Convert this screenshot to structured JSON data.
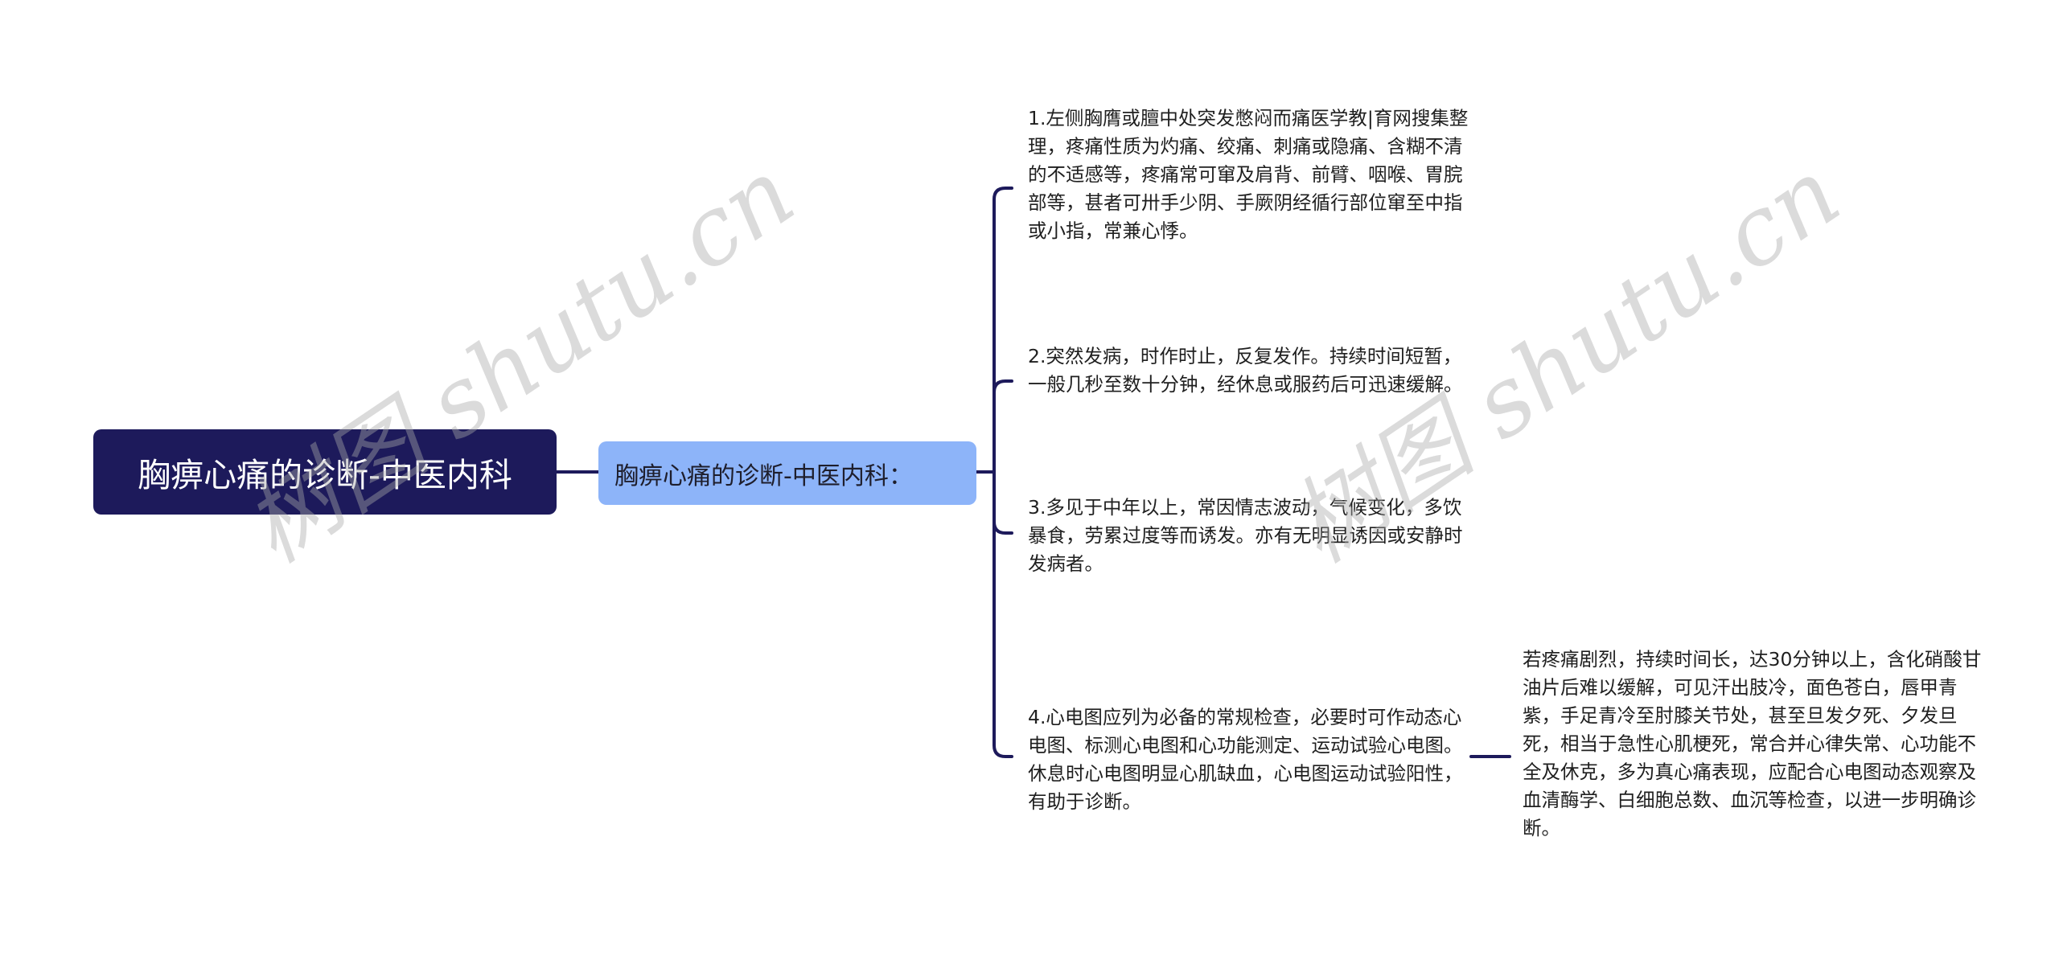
{
  "diagram": {
    "type": "mind-map",
    "root": {
      "label": "胸痹心痛的诊断-中医内科"
    },
    "branch": {
      "label": "胸痹心痛的诊断-中医内科："
    },
    "leaves": [
      {
        "text": "1.左侧胸膺或膻中处突发憋闷而痛医学教|育网搜集整理，疼痛性质为灼痛、绞痛、刺痛或隐痛、含糊不清的不适感等，疼痛常可窜及肩背、前臂、咽喉、胃脘部等，甚者可卅手少阴、手厥阴经循行部位窜至中指或小指，常兼心悸。"
      },
      {
        "text": "2.突然发病，时作时止，反复发作。持续时间短暂，一般几秒至数十分钟，经休息或服药后可迅速缓解。"
      },
      {
        "text": "3.多见于中年以上，常因情志波动，气候变化，多饮暴食，劳累过度等而诱发。亦有无明显诱因或安静时发病者。"
      },
      {
        "text": "4.心电图应列为必备的常规检查，必要时可作动态心电图、标测心电图和心功能测定、运动试验心电图。休息时心电图明显心肌缺血，心电图运动试验阳性，有助于诊断。"
      }
    ],
    "sub_leaf": {
      "text": "若疼痛剧烈，持续时间长，达30分钟以上，含化硝酸甘油片后难以缓解，可见汗出肢冷，面色苍白，唇甲青紫，手足青冷至肘膝关节处，甚至旦发夕死、夕发旦死，相当于急性心肌梗死，常合并心律失常、心功能不全及休克，多为真心痛表现，应配合心电图动态观察及血清酶学、白细胞总数、血沉等检查，以进一步明确诊断。"
    },
    "colors": {
      "root_fill": "#1d1a5b",
      "branch_fill": "#8db4f9",
      "connector": "#1d1a5b",
      "root_text": "#ffffff",
      "text": "#1f1f1f"
    }
  },
  "watermark": {
    "text_left": "树图 shutu.cn",
    "text_right": "树图 shutu.cn"
  }
}
